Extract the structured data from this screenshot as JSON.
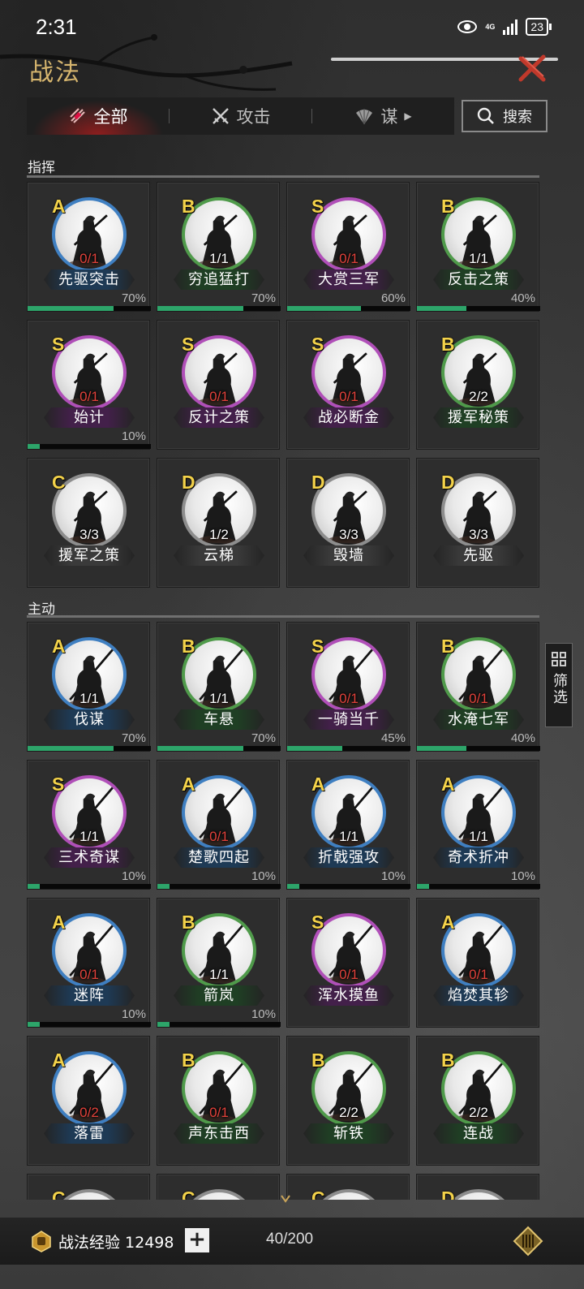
{
  "status_bar": {
    "time": "2:31",
    "network": "4G",
    "battery": "23"
  },
  "header": {
    "title": "战法"
  },
  "tabs": [
    {
      "label": "全部",
      "icon": "bundle-icon",
      "active": true
    },
    {
      "label": "攻击",
      "icon": "crossed-swords-icon",
      "active": false
    },
    {
      "label": "谋",
      "icon": "fan-icon",
      "active": false
    }
  ],
  "search": {
    "label": "搜索"
  },
  "side_filter": {
    "label": "筛选"
  },
  "sections": [
    {
      "title": "指挥",
      "cards": [
        {
          "grade": "A",
          "count": "0/1",
          "name": "先驱突击",
          "pct": "70%",
          "progress": 0.7,
          "color": "blue"
        },
        {
          "grade": "B",
          "count": "1/1",
          "name": "穷追猛打",
          "pct": "70%",
          "progress": 0.7,
          "color": "green"
        },
        {
          "grade": "S",
          "count": "0/1",
          "name": "大赏三军",
          "pct": "60%",
          "progress": 0.6,
          "color": "purple"
        },
        {
          "grade": "B",
          "count": "1/1",
          "name": "反击之策",
          "pct": "40%",
          "progress": 0.4,
          "color": "green"
        },
        {
          "grade": "S",
          "count": "0/1",
          "name": "始计",
          "pct": "10%",
          "progress": 0.1,
          "color": "purple"
        },
        {
          "grade": "S",
          "count": "0/1",
          "name": "反计之策",
          "pct": "",
          "progress": null,
          "color": "purple"
        },
        {
          "grade": "S",
          "count": "0/1",
          "name": "战必断金",
          "pct": "",
          "progress": null,
          "color": "purple"
        },
        {
          "grade": "B",
          "count": "2/2",
          "name": "援军秘策",
          "pct": "",
          "progress": null,
          "color": "green"
        },
        {
          "grade": "C",
          "count": "3/3",
          "name": "援军之策",
          "pct": "",
          "progress": null,
          "color": "gray"
        },
        {
          "grade": "D",
          "count": "1/2",
          "name": "云梯",
          "pct": "",
          "progress": null,
          "color": "gray"
        },
        {
          "grade": "D",
          "count": "3/3",
          "name": "毁墙",
          "pct": "",
          "progress": null,
          "color": "gray"
        },
        {
          "grade": "D",
          "count": "3/3",
          "name": "先驱",
          "pct": "",
          "progress": null,
          "color": "gray"
        }
      ]
    },
    {
      "title": "主动",
      "cards": [
        {
          "grade": "A",
          "count": "1/1",
          "name": "伐谋",
          "pct": "70%",
          "progress": 0.7,
          "color": "blue"
        },
        {
          "grade": "B",
          "count": "1/1",
          "name": "车悬",
          "pct": "70%",
          "progress": 0.7,
          "color": "green"
        },
        {
          "grade": "S",
          "count": "0/1",
          "name": "一骑当千",
          "pct": "45%",
          "progress": 0.45,
          "color": "purple"
        },
        {
          "grade": "B",
          "count": "0/1",
          "name": "水淹七军",
          "pct": "40%",
          "progress": 0.4,
          "color": "green"
        },
        {
          "grade": "S",
          "count": "1/1",
          "name": "三术奇谋",
          "pct": "10%",
          "progress": 0.1,
          "color": "purple"
        },
        {
          "grade": "A",
          "count": "0/1",
          "name": "楚歌四起",
          "pct": "10%",
          "progress": 0.1,
          "color": "blue"
        },
        {
          "grade": "A",
          "count": "1/1",
          "name": "折戟强攻",
          "pct": "10%",
          "progress": 0.1,
          "color": "blue"
        },
        {
          "grade": "A",
          "count": "1/1",
          "name": "奇术折冲",
          "pct": "10%",
          "progress": 0.1,
          "color": "blue"
        },
        {
          "grade": "A",
          "count": "0/1",
          "name": "迷阵",
          "pct": "10%",
          "progress": 0.1,
          "color": "blue"
        },
        {
          "grade": "B",
          "count": "1/1",
          "name": "箭岚",
          "pct": "10%",
          "progress": 0.1,
          "color": "green"
        },
        {
          "grade": "S",
          "count": "0/1",
          "name": "浑水摸鱼",
          "pct": "",
          "progress": null,
          "color": "purple"
        },
        {
          "grade": "A",
          "count": "0/1",
          "name": "焰焚其轸",
          "pct": "",
          "progress": null,
          "color": "blue"
        },
        {
          "grade": "A",
          "count": "0/2",
          "name": "落雷",
          "pct": "",
          "progress": null,
          "color": "blue"
        },
        {
          "grade": "B",
          "count": "0/1",
          "name": "声东击西",
          "pct": "",
          "progress": null,
          "color": "green"
        },
        {
          "grade": "B",
          "count": "2/2",
          "name": "斩铁",
          "pct": "",
          "progress": null,
          "color": "green"
        },
        {
          "grade": "B",
          "count": "2/2",
          "name": "连战",
          "pct": "",
          "progress": null,
          "color": "green"
        },
        {
          "grade": "C",
          "count": "",
          "name": "",
          "pct": "",
          "progress": null,
          "color": "gray"
        },
        {
          "grade": "C",
          "count": "",
          "name": "",
          "pct": "",
          "progress": null,
          "color": "gray"
        },
        {
          "grade": "C",
          "count": "",
          "name": "",
          "pct": "",
          "progress": null,
          "color": "gray"
        },
        {
          "grade": "D",
          "count": "",
          "name": "",
          "pct": "",
          "progress": null,
          "color": "gray"
        }
      ]
    }
  ],
  "footer": {
    "exp_label": "战法经验 12498",
    "capacity": "40/200"
  },
  "colors": {
    "blue": "#3f7fc1",
    "green": "#4f9a4a",
    "purple": "#b04fb8",
    "gray": "#8d8d8d",
    "blue_tag": "#1e3a55",
    "green_tag": "#1f3f24",
    "purple_tag": "#43204a",
    "gray_tag": "#3a3a3a",
    "title_gold": "#d6b56e",
    "progress_green": "#2da56a",
    "count_zero_red": "#e0413a"
  }
}
